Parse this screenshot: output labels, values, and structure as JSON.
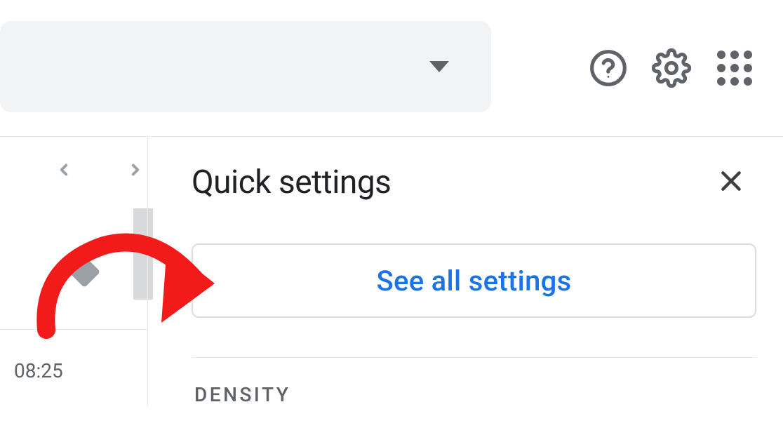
{
  "panel": {
    "title": "Quick settings",
    "see_all_label": "See all settings",
    "density_label": "DENSITY"
  },
  "left": {
    "time": "08:25"
  }
}
